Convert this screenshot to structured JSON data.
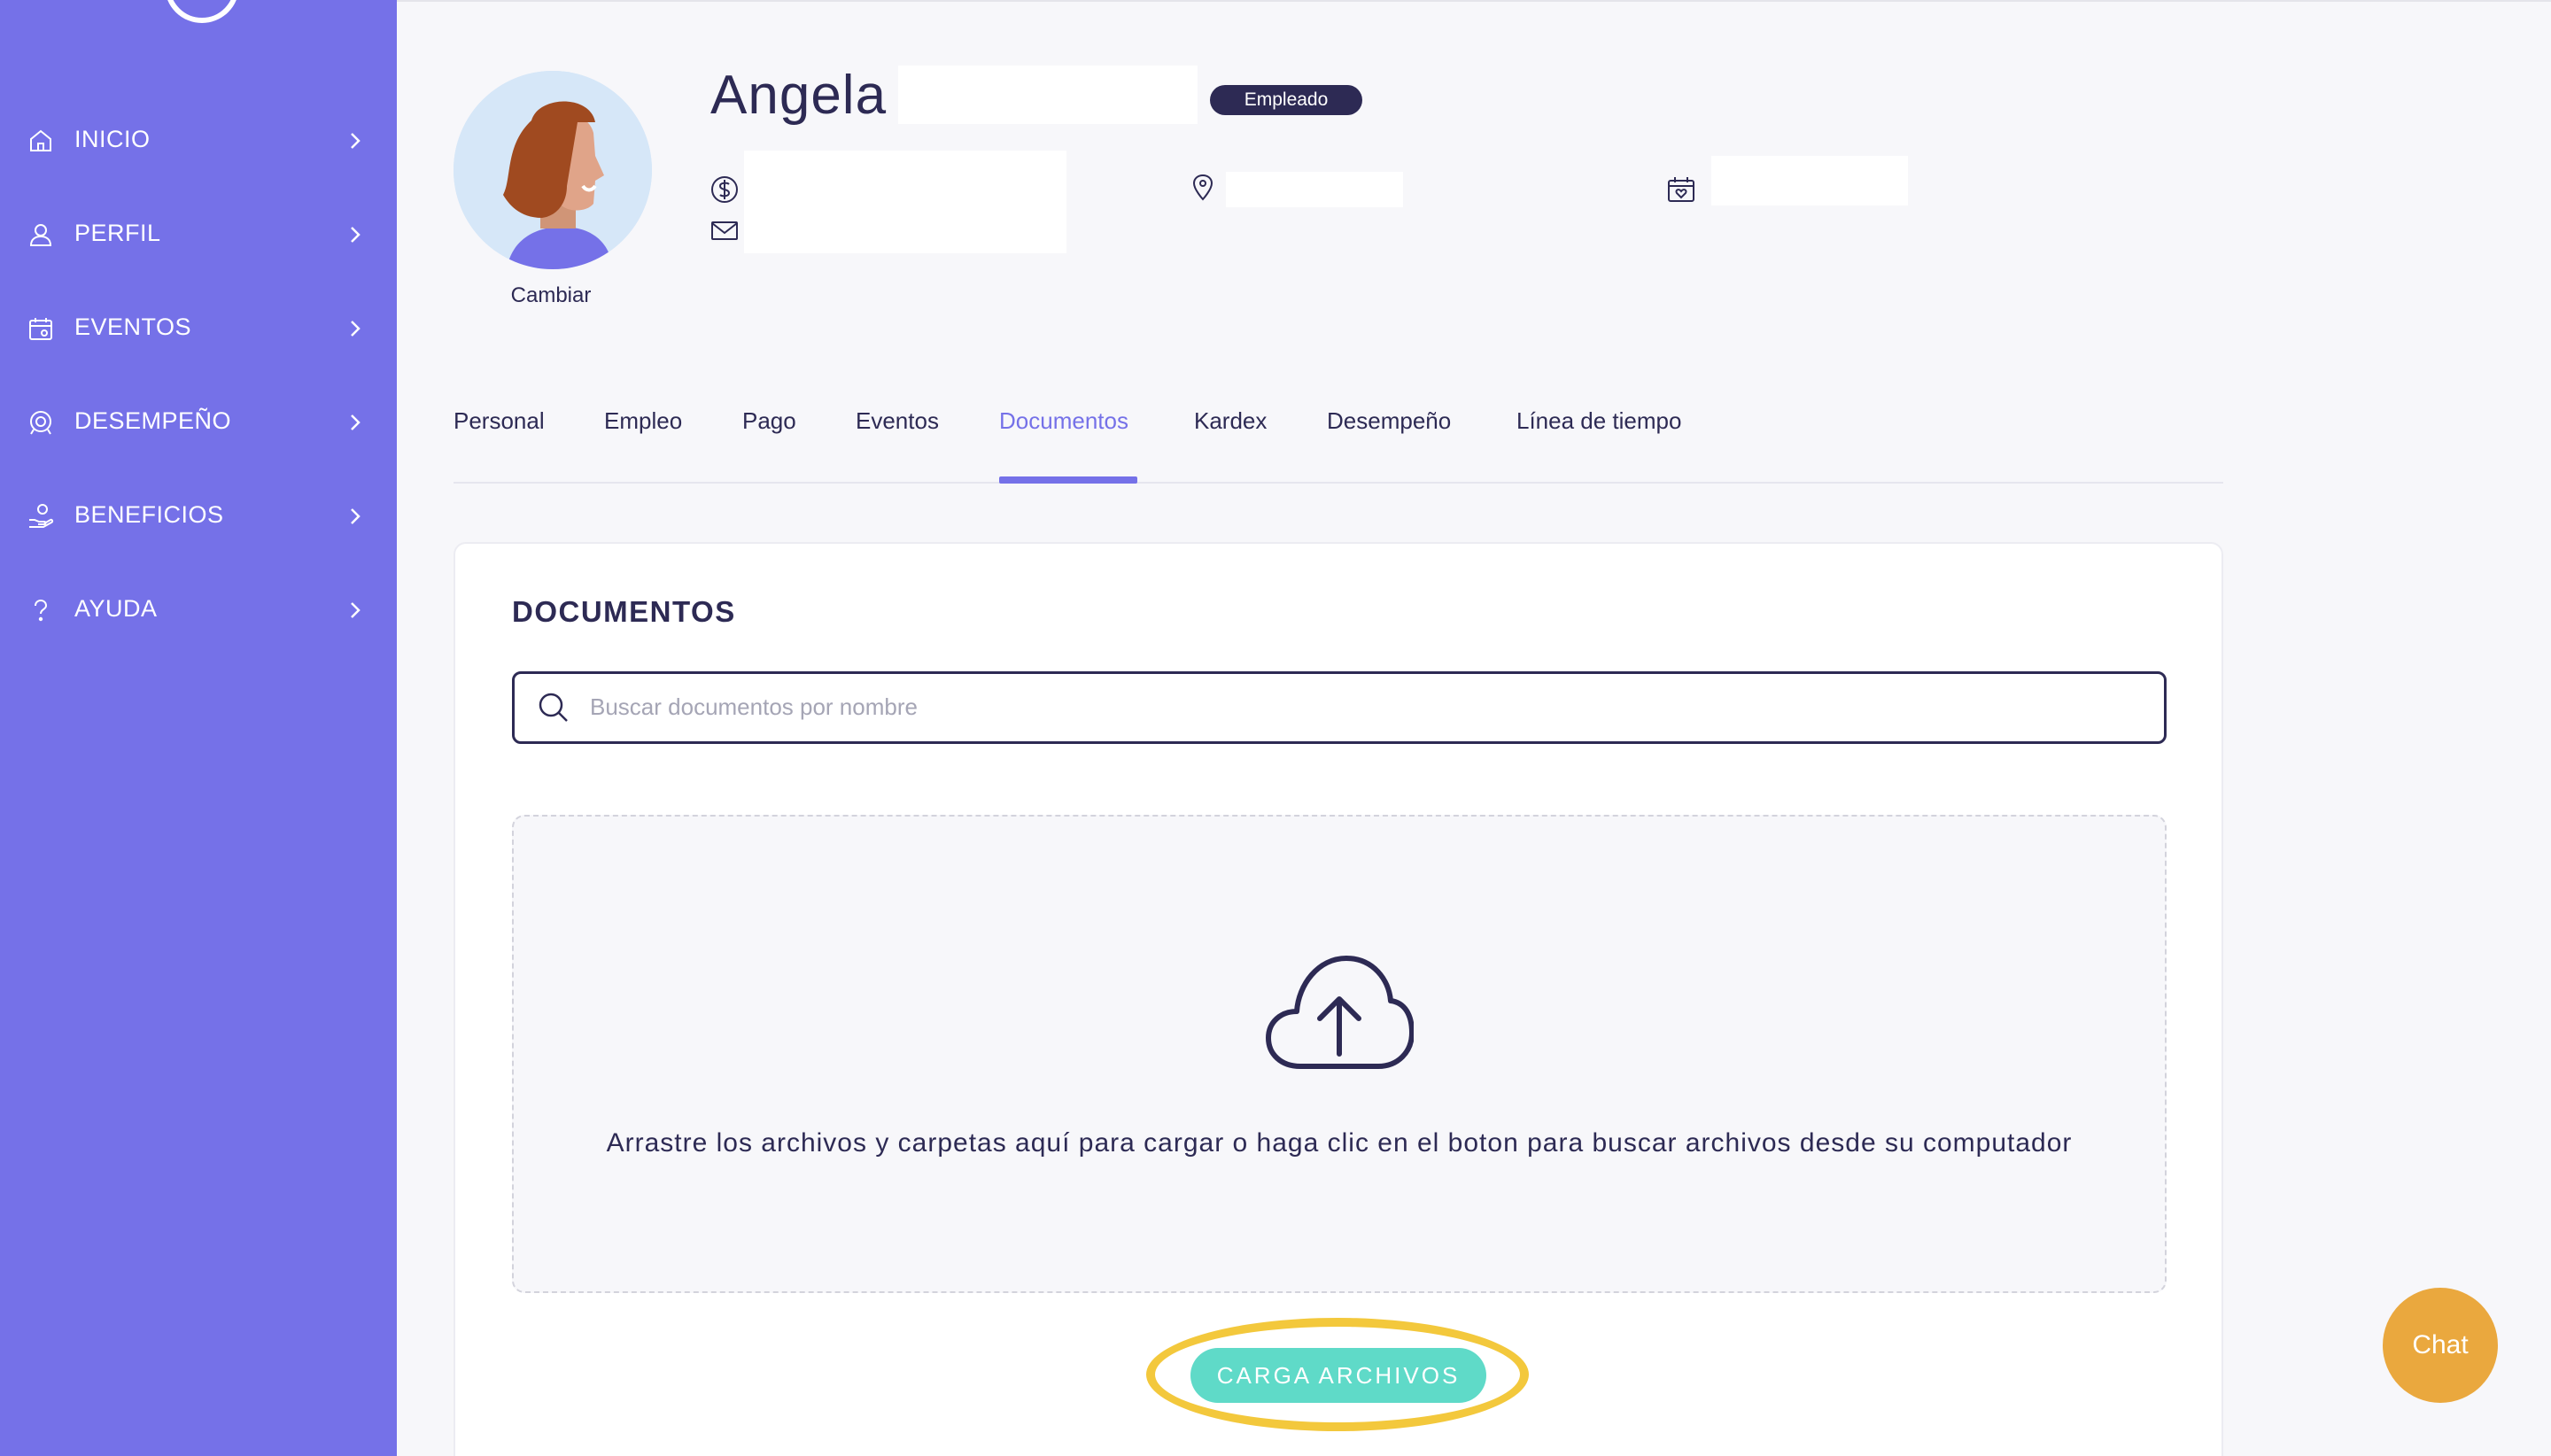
{
  "sidebar": {
    "items": [
      {
        "label": "INICIO",
        "icon": "home-icon"
      },
      {
        "label": "PERFIL",
        "icon": "user-icon"
      },
      {
        "label": "EVENTOS",
        "icon": "calendar-icon"
      },
      {
        "label": "DESEMPEÑO",
        "icon": "performance-icon"
      },
      {
        "label": "BENEFICIOS",
        "icon": "benefits-icon"
      },
      {
        "label": "AYUDA",
        "icon": "help-icon"
      }
    ]
  },
  "profile": {
    "name": "Angela",
    "badge": "Empleado",
    "change_label": "Cambiar"
  },
  "tabs": [
    {
      "label": "Personal"
    },
    {
      "label": "Empleo"
    },
    {
      "label": "Pago"
    },
    {
      "label": "Eventos"
    },
    {
      "label": "Documentos",
      "active": true
    },
    {
      "label": "Kardex"
    },
    {
      "label": "Desempeño"
    },
    {
      "label": "Línea de tiempo"
    }
  ],
  "documents": {
    "title": "DOCUMENTOS",
    "search_placeholder": "Buscar documentos por nombre",
    "search_value": "",
    "drop_text": "Arrastre los archivos y carpetas aquí para cargar o haga clic en el boton para buscar archivos desde su computador",
    "upload_label": "CARGA ARCHIVOS"
  },
  "chat": {
    "label": "Chat"
  },
  "colors": {
    "sidebar": "#7571e8",
    "primary_text": "#2d2a54",
    "accent": "#7571e8",
    "upload_button": "#5fdac8",
    "highlight": "#f3c83c",
    "chat": "#eaa83e"
  }
}
